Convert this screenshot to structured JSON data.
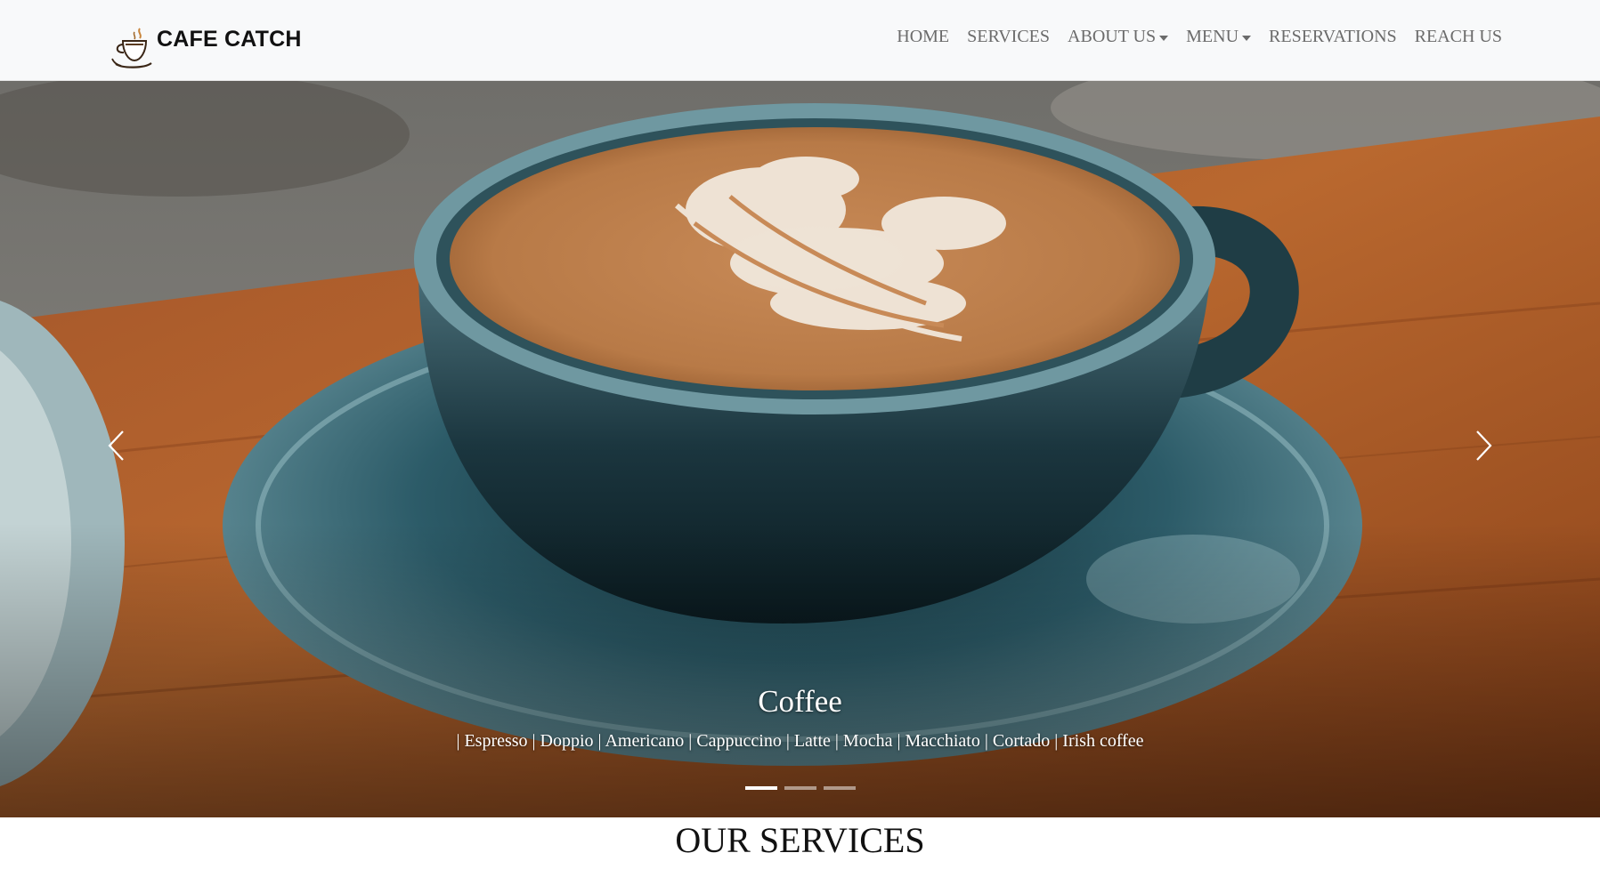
{
  "navbar": {
    "brand_name": "CAFE CATCH",
    "logo_icon": "coffee-cup-logo",
    "links": [
      {
        "label": "HOME",
        "dropdown": false
      },
      {
        "label": "SERVICES",
        "dropdown": false
      },
      {
        "label": "ABOUT US",
        "dropdown": true
      },
      {
        "label": "MENU",
        "dropdown": true
      },
      {
        "label": "RESERVATIONS",
        "dropdown": false
      },
      {
        "label": "REACH US",
        "dropdown": false
      }
    ]
  },
  "carousel": {
    "slide_title": "Coffee",
    "slide_text": "| Espresso | Doppio | Americano | Cappuccino | Latte | Mocha | Macchiato | Cortado | Irish coffee",
    "prev_icon": "chevron-left-icon",
    "next_icon": "chevron-right-icon",
    "indicators": 3,
    "active_indicator": 0
  },
  "sections": {
    "services_title": "OUR SERVICES"
  },
  "colors": {
    "navbar_bg": "#f8f9fa",
    "nav_text": "#6b6b6b",
    "brand_text": "#111111"
  }
}
